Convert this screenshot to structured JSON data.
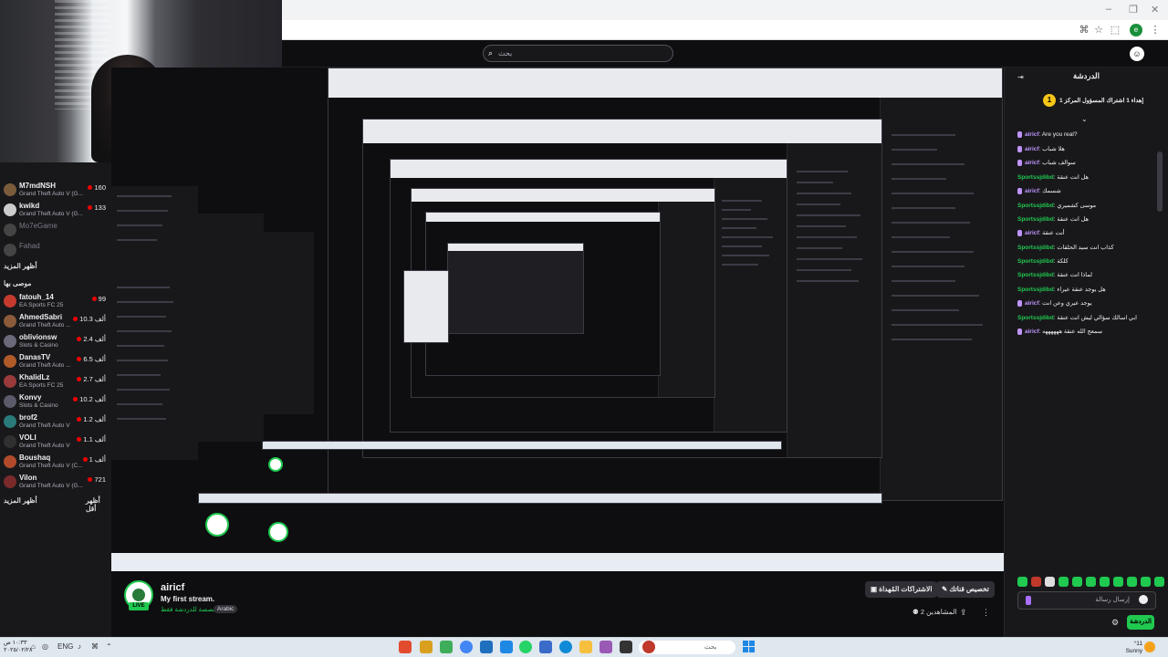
{
  "browser": {
    "search_placeholder": "بحث",
    "profile_initial": "e"
  },
  "left_sidebar": {
    "channels_top": [
      {
        "name": "M7mdNSH",
        "game": "Grand Theft Auto V (G...",
        "viewers": "160",
        "color": "#7a5c3b"
      },
      {
        "name": "kwikd",
        "game": "Grand Theft Auto V (G...",
        "viewers": "133",
        "color": "#cccccc"
      },
      {
        "name": "Mo7eGame",
        "game": "",
        "viewers": "",
        "color": "#555555",
        "offline": true
      },
      {
        "name": "Fahad",
        "game": "",
        "viewers": "",
        "color": "#555555",
        "offline": true
      }
    ],
    "show_more_1": "أظهر المزيد",
    "recommended_title": "موصى بها",
    "channels_rec": [
      {
        "name": "fatouh_14",
        "game": "EA Sports FC 25",
        "viewers": "99",
        "color": "#c43a2f"
      },
      {
        "name": "AhmedSabri",
        "game": "Grand Theft Auto ...",
        "viewers": "10.3 ألف",
        "color": "#8a5a3a"
      },
      {
        "name": "oblivionsw",
        "game": "Slots & Casino",
        "viewers": "2.4 ألف",
        "color": "#6a6a7a"
      },
      {
        "name": "DanasTV",
        "game": "Grand Theft Auto ...",
        "viewers": "6.5 ألف",
        "color": "#b05a2a"
      },
      {
        "name": "KhalidLz",
        "game": "EA Sports FC 25",
        "viewers": "2.7 ألف",
        "color": "#9a3a3a"
      },
      {
        "name": "Konvy",
        "game": "Slots & Casino",
        "viewers": "10.2 ألف",
        "color": "#5a5a6a"
      },
      {
        "name": "brof2",
        "game": "Grand Theft Auto V",
        "viewers": "1.2 ألف",
        "color": "#2a7a7a"
      },
      {
        "name": "VOLI",
        "game": "Grand Theft Auto V",
        "viewers": "1.1 ألف",
        "color": "#303030"
      },
      {
        "name": "Boushaq",
        "game": "Grand Theft Auto V (C...",
        "viewers": "1 ألف",
        "color": "#b04a2a"
      },
      {
        "name": "Vilon",
        "game": "Grand Theft Auto V (G...",
        "viewers": "721",
        "color": "#7a2a2a"
      }
    ],
    "show_more_2": "أظهر المزيد",
    "show_less": "أظهر أقل"
  },
  "stream": {
    "name": "airicf",
    "title": "My first stream.",
    "category": "مخصصة للدردشة فقط",
    "tag": "Arabic",
    "live_label": "LIVE",
    "subscribe_label": "الاشتراكات المُهداة",
    "customize_label": "تخصيص قناتك",
    "viewers_label": "المشاهدين 2"
  },
  "chat": {
    "title": "الدردشة",
    "pinned_count": "1",
    "pinned_text": "إهداء 1 اشتراك المسؤول المركز 1",
    "messages": [
      {
        "user": "airicf",
        "text": "Are you real?",
        "color": "purple"
      },
      {
        "user": "airicf",
        "text": "هلا شباب",
        "color": "purple"
      },
      {
        "user": "airicf",
        "text": "سوالف شباب",
        "color": "purple"
      },
      {
        "user": "Sportssjdibd",
        "text": "هل انت عنقة",
        "color": "green"
      },
      {
        "user": "airicf",
        "text": "شسمك",
        "color": "purple"
      },
      {
        "user": "Sportssjdibd",
        "text": "موسى كشميري",
        "color": "green"
      },
      {
        "user": "Sportssjdibd",
        "text": "هل انت عنقة",
        "color": "green"
      },
      {
        "user": "airicf",
        "text": "أنت عنقة",
        "color": "purple"
      },
      {
        "user": "Sportssjdibd",
        "text": "كذاب انت سيد الحلقات",
        "color": "green"
      },
      {
        "user": "Sportssjdibd",
        "text": "كلكة",
        "color": "green"
      },
      {
        "user": "Sportssjdibd",
        "text": "لماذا انت عنقة",
        "color": "green"
      },
      {
        "user": "Sportssjdibd",
        "text": "هل يوجد عنقة عيراء",
        "color": "green"
      },
      {
        "user": "airicf",
        "text": "يوجد عيري وعن انت",
        "color": "purple"
      },
      {
        "user": "Sportssjdibd",
        "text": "ابي اسالك سؤالي ليش انت عنقة",
        "color": "green"
      },
      {
        "user": "airicf",
        "text": "سمعج الله عنقة ههههههه",
        "color": "purple"
      }
    ],
    "input_placeholder": "إرسال رسالة",
    "send_label": "الدردشة"
  },
  "taskbar": {
    "time": "١٠:٣٣ ص",
    "date": "٢٠٢٥/٠٢/٢٨",
    "language": "ENG",
    "search_label": "بحث",
    "weather_temp": "°11",
    "weather_text": "Sunny"
  },
  "colors": {
    "accent_green": "#20c950",
    "twitch_purple": "#bf94ff",
    "background": "#0e0e10",
    "panel": "#18181b"
  }
}
